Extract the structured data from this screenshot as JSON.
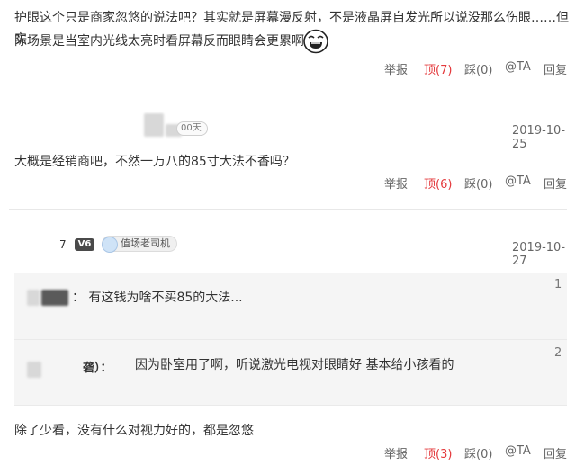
{
  "comments": [
    {
      "text_line1": "护眼这个只是商家忽悠的说法吧？其实就是屏幕漫反射，不是液晶屏自发光所以说没那么伤眼……但实",
      "text_line2": "际场景是当室内光线太亮时看屏幕反而眼睛会更累啊",
      "actions": {
        "report": "举报",
        "up": "顶(7)",
        "down": "踩(0)",
        "at": "@TA",
        "reply": "回复"
      }
    },
    {
      "user_suffix": "00天",
      "date": "2019-10-25",
      "text": "大概是经销商吧，不然一万八的85寸大法不香吗？",
      "actions": {
        "report": "举报",
        "up": "顶(6)",
        "down": "踩(0)",
        "at": "@TA",
        "reply": "回复"
      }
    },
    {
      "user_suffix": "7",
      "level": "V6",
      "tag": "值场老司机",
      "date": "2019-10-27",
      "quotes": [
        {
          "floor": "1",
          "text": "：  有这钱为啥不买85的大法..."
        },
        {
          "floor": "2",
          "author_suffix": "砻）：",
          "text": "因为卧室用了啊，听说激光电视对眼睛好 基本给小孩看的"
        }
      ],
      "text": "除了少看，没有什么对视力好的，都是忽悠",
      "actions": {
        "report": "举报",
        "up": "顶(3)",
        "down": "踩(0)",
        "at": "@TA",
        "reply": "回复"
      }
    }
  ],
  "colors": {
    "up_active": "#e4393c",
    "text": "#333333",
    "muted": "#666666"
  },
  "icons": {
    "emoji": "laughing-face-emoticon"
  }
}
